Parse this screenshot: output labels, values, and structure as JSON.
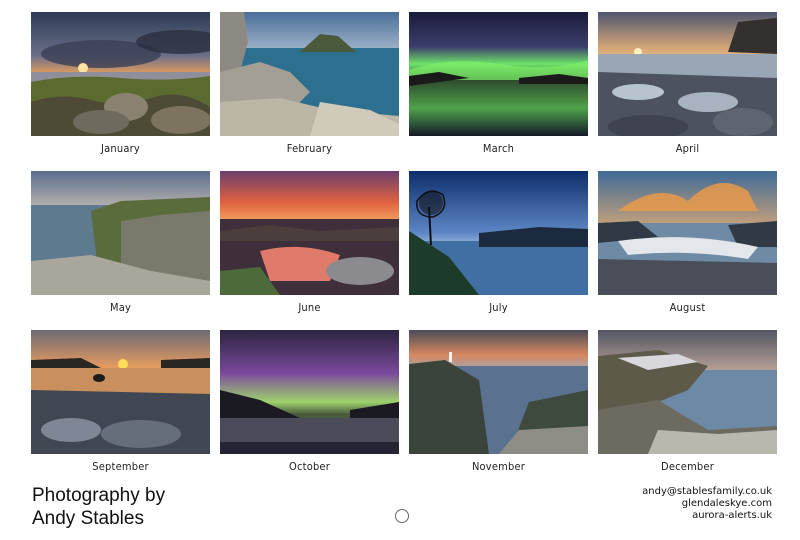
{
  "months": [
    {
      "label": "January"
    },
    {
      "label": "February"
    },
    {
      "label": "March"
    },
    {
      "label": "April"
    },
    {
      "label": "May"
    },
    {
      "label": "June"
    },
    {
      "label": "July"
    },
    {
      "label": "August"
    },
    {
      "label": "September"
    },
    {
      "label": "October"
    },
    {
      "label": "November"
    },
    {
      "label": "December"
    }
  ],
  "footer": {
    "title_line1": "Photography by",
    "title_line2": "Andy Stables",
    "contact": {
      "email": "andy@stablesfamily.co.uk",
      "site1": "glendaleskye.com",
      "site2": "aurora-alerts.uk"
    }
  },
  "colors": {
    "background": "#ffffff",
    "text": "#222222"
  }
}
